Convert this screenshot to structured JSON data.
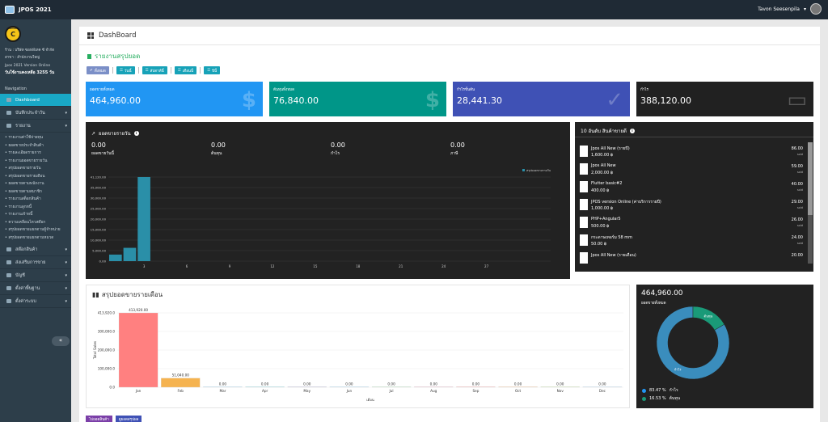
{
  "app": {
    "title": "JPOS 2021",
    "user": "Tavon Seesenpila"
  },
  "sidebar": {
    "badge_small": "Control",
    "badge_letter": "C",
    "shop": "ร้าน : บริษัท ซอฟท์เทค ซี จำกัด",
    "branch": "สาขา : สำนักงานใหญ่",
    "version": "Jpos 2021 Version Online",
    "days_left": "วันใช้งานคงเหลือ 3255 วัน",
    "nav_heading": "Navigation",
    "items": [
      {
        "label": "Dashboard"
      },
      {
        "label": "บันทึกประจำวัน"
      },
      {
        "label": "รายงาน"
      }
    ],
    "report_items": [
      "รายงานค่าใช้จ่ายทุน",
      "ยอดขายประจำสินค้า",
      "รายละเอียดรายการ",
      "รายงานยอดขายรายวัน",
      "สรุปยอดขายรายวัน",
      "สรุปยอดขายรายเดือน",
      "ยอดขายตามพนักงาน",
      "ยอดขายตามสมาชิก",
      "รายงานสต็อกสินค้า",
      "รายงานลูกหนี้",
      "รายงานเจ้าหนี้",
      "ความเคลื่อนไหวสต๊อก",
      "สรุปยอดขายแยกตามผู้จำหน่าย",
      "สรุปยอดขายแยกตามหมวด"
    ],
    "bottom_items": [
      {
        "label": "สต๊อกสินค้า"
      },
      {
        "label": "ส่งเสริมการขาย"
      },
      {
        "label": "บัญชี"
      },
      {
        "label": "ตั้งค่าพื้นฐาน"
      },
      {
        "label": "ตั้งค่าระบบ"
      }
    ],
    "collapse_glyph": "«"
  },
  "page": {
    "title": "DashBoard",
    "section": "รายงานสรุปยอด"
  },
  "filters": [
    {
      "label": "ทั้งหมด",
      "color": "#7b8fc7"
    },
    {
      "label": "วันนี้",
      "color": "#17a2b8"
    },
    {
      "label": "สัปดาห์นี้",
      "color": "#17a2b8"
    },
    {
      "label": "เดือนนี้",
      "color": "#17a2b8"
    },
    {
      "label": "ปีนี้",
      "color": "#17a2b8"
    }
  ],
  "cards": [
    {
      "label": "ยอดขายทั้งหมด",
      "value": "464,960.00",
      "color": "#2196f3",
      "icon": "dollar-icon",
      "glyph": "$"
    },
    {
      "label": "ต้นทุนทั้งหมด",
      "value": "76,840.00",
      "color": "#009688",
      "icon": "document-dollar-icon",
      "glyph": "$"
    },
    {
      "label": "กำไรขั้นต้น",
      "value": "28,441.30",
      "color": "#3f51b5",
      "icon": "check-shield-icon",
      "glyph": "✓"
    },
    {
      "label": "กำไร",
      "value": "388,120.00",
      "color": "#212121",
      "icon": "cash-icon",
      "glyph": "▭"
    }
  ],
  "daily": {
    "title": "ยอดขายรายวัน",
    "stats": [
      {
        "value": "0.00",
        "label": "ยอดขายวันนี้"
      },
      {
        "value": "0.00",
        "label": "ต้นทุน"
      },
      {
        "value": "0.00",
        "label": "กำไร"
      },
      {
        "value": "0.00",
        "label": "ภาษี"
      }
    ]
  },
  "top_products": {
    "title": "10 อันดับ สินค้าขายดี",
    "items": [
      {
        "name": "Jpos All New (รายปี)",
        "price": "1,600.00 ฿",
        "qty": "86.00",
        "unit": "sold"
      },
      {
        "name": "Jpos All New",
        "price": "2,000.00 ฿",
        "qty": "59.00",
        "unit": "sold"
      },
      {
        "name": "Flutter basic#2",
        "price": "400.00 ฿",
        "qty": "40.00",
        "unit": "sold"
      },
      {
        "name": "JPOS version Online (ค่าบริการรายปี)",
        "price": "1,000.00 ฿",
        "qty": "29.00",
        "unit": "sold"
      },
      {
        "name": "PHP+Angular5",
        "price": "500.00 ฿",
        "qty": "26.00",
        "unit": "sold"
      },
      {
        "name": "กระดาษเทอร์ม 58 mm",
        "price": "50.00 ฿",
        "qty": "24.00",
        "unit": "sold"
      },
      {
        "name": "Jpos All New (รายเดือน)",
        "price": "",
        "qty": "20.00",
        "unit": ""
      }
    ]
  },
  "monthly": {
    "title": "สรุปยอดขายรายเดือน"
  },
  "donut": {
    "total": "464,960.00",
    "label": "ยอดขายทั้งหมด",
    "slices": [
      {
        "label": "กำไร",
        "percent": "83.47 %",
        "value": 83.47,
        "color": "#3a8dbd"
      },
      {
        "label": "ต้นทุน",
        "percent": "16.53 %",
        "value": 16.53,
        "color": "#1a9a78"
      }
    ]
  },
  "bottom_buttons": [
    {
      "label": "ไปยอดสินค้า",
      "color": "#7b3fa8"
    },
    {
      "label": "ดูยอดสรุปผล",
      "color": "#3f51b5"
    }
  ],
  "chart_data": [
    {
      "type": "bar",
      "title": "",
      "legend": [
        "สรุปยอดขายรายวัน"
      ],
      "categories": [
        "1",
        "2",
        "3",
        "4",
        "5",
        "6",
        "7",
        "8",
        "9",
        "10",
        "11",
        "12",
        "13",
        "14",
        "15",
        "16",
        "17",
        "18",
        "19",
        "20",
        "21",
        "22",
        "23",
        "24",
        "25",
        "26",
        "27",
        "28",
        "29",
        "30",
        "31"
      ],
      "x_ticks": [
        "3",
        "6",
        "9",
        "12",
        "15",
        "18",
        "21",
        "24",
        "27"
      ],
      "y_ticks": [
        "0.00",
        "5,000.00",
        "10,000.00",
        "15,000.00",
        "20,000.00",
        "25,000.00",
        "30,000.00",
        "35,000.00",
        "41,120.00"
      ],
      "series": [
        {
          "name": "สรุปยอดขายรายวัน",
          "color": "#2a8fa8",
          "values": [
            3200,
            6500,
            41120,
            0,
            0,
            0,
            0,
            0,
            0,
            0,
            0,
            0,
            0,
            0,
            0,
            0,
            0,
            0,
            0,
            0,
            0,
            0,
            0,
            0,
            0,
            0,
            0,
            0,
            0,
            0,
            0
          ]
        }
      ],
      "ylim": [
        0,
        41120
      ]
    },
    {
      "type": "bar",
      "title": "",
      "xlabel": "เดือน",
      "ylabel": "Total Sales",
      "categories": [
        "Jan",
        "Feb",
        "Mar",
        "Apr",
        "May",
        "Jun",
        "Jul",
        "Aug",
        "Sep",
        "Oct",
        "Nov",
        "Dec"
      ],
      "values": [
        413920,
        51040,
        0,
        0,
        0,
        0,
        0,
        0,
        0,
        0,
        0,
        0
      ],
      "value_labels": [
        "413,920.00",
        "51,040.00",
        "0.00",
        "0.00",
        "0.00",
        "0.00",
        "0.00",
        "0.00",
        "0.00",
        "0.00",
        "0.00",
        "0.00"
      ],
      "colors": [
        "#ff8080",
        "#f5b350",
        "#a0d4f0",
        "#80d0e0",
        "#b8b8d8",
        "#a0d4f0",
        "#a8e0b8",
        "#e8b0c8",
        "#f5a0a0",
        "#f5c090",
        "#c0e0a0",
        "#b8d8f0"
      ],
      "y_ticks": [
        "0.0",
        "100,000.0",
        "200,000.0",
        "300,000.0",
        "413,920.0"
      ],
      "ylim": [
        0,
        413920
      ]
    }
  ]
}
